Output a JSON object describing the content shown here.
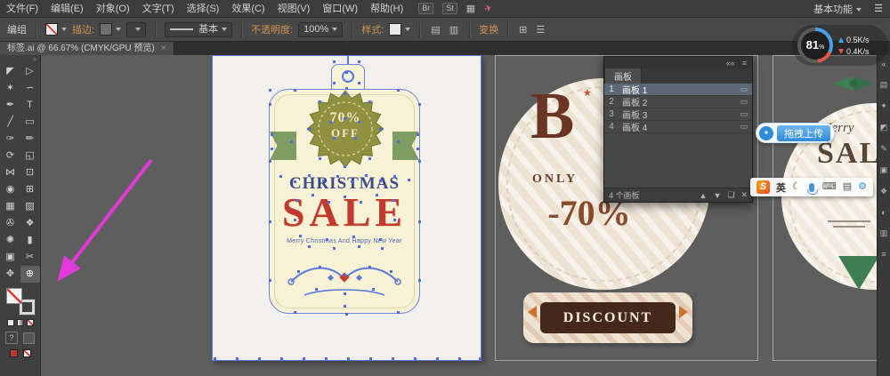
{
  "menubar": {
    "items": [
      "文件(F)",
      "编辑(E)",
      "对象(O)",
      "文字(T)",
      "选择(S)",
      "效果(C)",
      "视图(V)",
      "窗口(W)",
      "帮助(H)"
    ],
    "br_label": "Br",
    "st_label": "St",
    "workspace_label": "基本功能"
  },
  "menubar_icons": {
    "layout": "▦",
    "share": "✈",
    "hamburger": "☰"
  },
  "controlbar": {
    "selection_type": "编组",
    "stroke_label": "描边:",
    "brush_style": "基本",
    "opacity_label": "不透明度:",
    "opacity_value": "100%",
    "style_label": "样式:",
    "transform_label": "变换"
  },
  "controlbar_icons": {
    "doc1": "▤",
    "doc2": "▥",
    "grid": "⊞",
    "more": "☰"
  },
  "tabbar": {
    "title": "标签.ai @ 66.67% (CMYK/GPU 预览)",
    "close_glyph": "×"
  },
  "toolbar": {
    "collapse_glyph": "»",
    "question_glyph": "?",
    "tools": [
      {
        "name": "selection",
        "glyph": "◤"
      },
      {
        "name": "direct-selection",
        "glyph": "▷"
      },
      {
        "name": "magic-wand",
        "glyph": "✶"
      },
      {
        "name": "lasso",
        "glyph": "∽"
      },
      {
        "name": "pen",
        "glyph": "✒"
      },
      {
        "name": "type",
        "glyph": "T"
      },
      {
        "name": "line-segment",
        "glyph": "╱"
      },
      {
        "name": "rectangle",
        "glyph": "▭"
      },
      {
        "name": "paintbrush",
        "glyph": "✑"
      },
      {
        "name": "pencil",
        "glyph": "✏"
      },
      {
        "name": "rotate",
        "glyph": "⟳"
      },
      {
        "name": "scale",
        "glyph": "◱"
      },
      {
        "name": "width",
        "glyph": "⋈"
      },
      {
        "name": "free-transform",
        "glyph": "⊡"
      },
      {
        "name": "shape-builder",
        "glyph": "◉"
      },
      {
        "name": "perspective-grid",
        "glyph": "⊞"
      },
      {
        "name": "mesh",
        "glyph": "▦"
      },
      {
        "name": "gradient",
        "glyph": "▨"
      },
      {
        "name": "eyedropper",
        "glyph": "✇"
      },
      {
        "name": "blend",
        "glyph": "❖"
      },
      {
        "name": "symbol-sprayer",
        "glyph": "✺"
      },
      {
        "name": "column-graph",
        "glyph": "▮"
      },
      {
        "name": "artboard",
        "glyph": "▣"
      },
      {
        "name": "slice",
        "glyph": "✂"
      },
      {
        "name": "hand",
        "glyph": "✥"
      },
      {
        "name": "zoom",
        "glyph": "⊕"
      }
    ]
  },
  "netspeed": {
    "percent": "81",
    "unit": "%",
    "up": "0.5K/s",
    "down": "0.4K/s"
  },
  "artboards_panel": {
    "title": "画板",
    "collapse_glyph": "««",
    "menu_glyph": "≡",
    "row_icon": "▭",
    "rows": [
      {
        "num": "1",
        "name": "画板 1"
      },
      {
        "num": "2",
        "name": "画板 2"
      },
      {
        "num": "3",
        "name": "画板 3"
      },
      {
        "num": "4",
        "name": "画板 4"
      }
    ],
    "footer_count": "4 个画板",
    "footer_icons": {
      "up": "▲",
      "down": "▼",
      "new": "❏",
      "del": "✕"
    }
  },
  "upload_button": {
    "label": "拖拽上传",
    "logo_glyph": "✦"
  },
  "ime_bar": {
    "logo": "S",
    "mode": "英",
    "moon": "☾",
    "keyboard": "⌨",
    "grid": "▤",
    "toolbox": "⚙"
  },
  "canvas": {
    "tag": {
      "badge_top": "70%",
      "badge_bottom": "OFF",
      "title": "CHRISTMAS",
      "sale": "SALE",
      "subtitle": "Merry Christmas And Happy New Year"
    },
    "badge2": {
      "letter": "B",
      "star": "★",
      "only": "ONLY",
      "percent": "-70%",
      "discount": "DISCOUNT"
    },
    "badge3": {
      "script": "Merry",
      "sale": "SALE"
    }
  },
  "dock_icons": [
    "«",
    "▤",
    "✦",
    "◩",
    "✎",
    "▣",
    "❖",
    "◐",
    "▥",
    "≡"
  ],
  "colors": {
    "selection_blue": "#5b79d6",
    "arrow_magenta": "#e23ad8",
    "sale_red": "#c03a30",
    "tag_cream": "#f7f2d6",
    "link_orange": "#cf9452",
    "canvas_gray": "#5e5e5e"
  }
}
